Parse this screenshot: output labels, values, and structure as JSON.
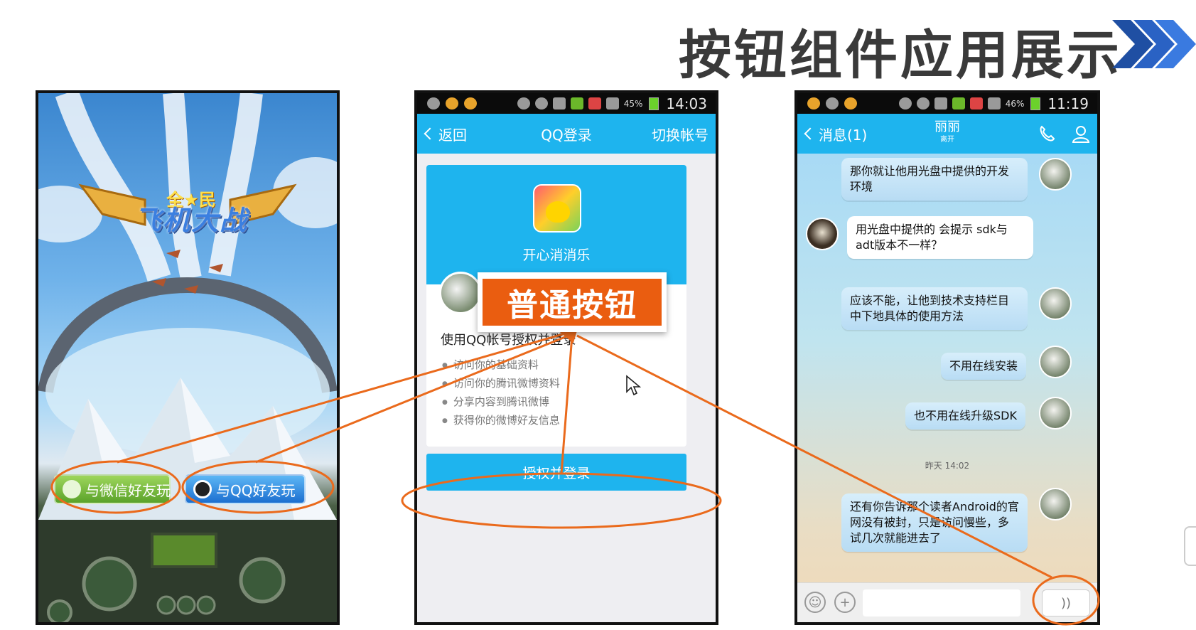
{
  "title": "按钮组件应用展示",
  "game": {
    "logo_top": "全★民",
    "logo_main": "飞机大战",
    "btn_wechat": "与微信好友玩",
    "btn_qq": "与QQ好友玩"
  },
  "phone2": {
    "status_time": "14:03",
    "battery": "45%",
    "nav_back": "返回",
    "nav_title": "QQ登录",
    "nav_right": "切换帐号",
    "app_name": "开心消消乐",
    "perm_title": "使用QQ帐号授权并登录",
    "permissions": [
      "访问你的基础资料",
      "访问你的腾讯微博资料",
      "分享内容到腾讯微博",
      "获得你的微博好友信息"
    ],
    "auth_button": "授权并登录"
  },
  "phone3": {
    "status_time": "11:19",
    "battery": "46%",
    "nav_back": "消息(1)",
    "contact_name": "丽丽",
    "contact_status": "离开",
    "messages": [
      {
        "side": "mine",
        "text": "那你就让他用光盘中提供的开发环境"
      },
      {
        "side": "theirs",
        "text": "用光盘中提供的 会提示 sdk与adt版本不一样？"
      },
      {
        "side": "mine",
        "text": "应该不能，让他到技术支持栏目中下地具体的使用方法"
      },
      {
        "side": "mine",
        "text": "不用在线安装"
      },
      {
        "side": "mine",
        "text": "也不用在线升级SDK"
      },
      {
        "side": "mine",
        "text": "还有你告诉那个读者Android的官网没有被封，只是访问慢些，多试几次就能进去了"
      }
    ],
    "time_label": "昨天 14:02",
    "voice_symbol": "))"
  },
  "callout": "普通按钮",
  "colors": {
    "accent_orange": "#ea5d10",
    "qq_blue": "#1eb4ee",
    "title_gray": "#3a3a3a",
    "chevron_blue": "#1f4fa3"
  },
  "icons": [
    "chevron-left-icon",
    "phone-icon",
    "person-icon",
    "emoji-icon",
    "plus-icon",
    "voice-icon",
    "cursor-icon"
  ]
}
